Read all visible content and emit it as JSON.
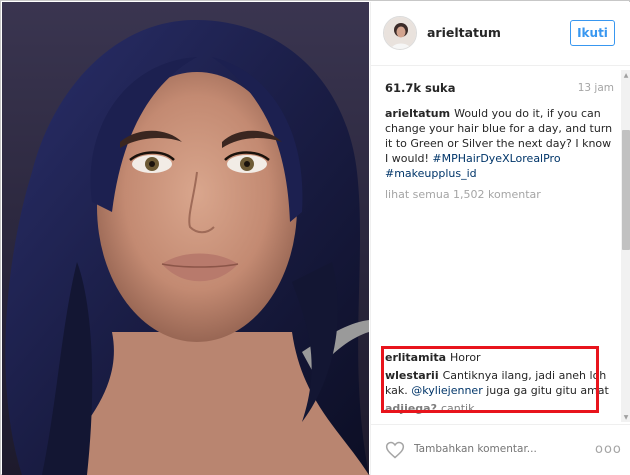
{
  "post": {
    "username": "arieltatum",
    "follow_label": "Ikuti",
    "likes": "61.7k suka",
    "time": "13 jam",
    "caption": {
      "user": "arieltatum",
      "text": "Would you do it, if you can change your hair blue for a day, and turn it to Green or Silver the next day? I know I would!",
      "hashtags": "#MPHairDyeXLorealPro #makeupplus_id"
    },
    "view_all": "lihat semua 1,502 komentar"
  },
  "comments": [
    {
      "user": "erlitamita",
      "text": "Horor"
    },
    {
      "user": "wlestarii",
      "text_before": "Cantiknya ilang, jadi aneh loh kak.",
      "mention": "@kyliejenner",
      "text_after": "juga ga gitu gitu amat"
    },
    {
      "user": "adjiega?",
      "text": "cantik"
    }
  ],
  "footer": {
    "placeholder": "Tambahkan komentar...",
    "more": "ooo"
  },
  "colors": {
    "accent": "#3897f0",
    "highlight": "#e8141c",
    "hashtag": "#003569",
    "muted": "#a5a5a5"
  }
}
